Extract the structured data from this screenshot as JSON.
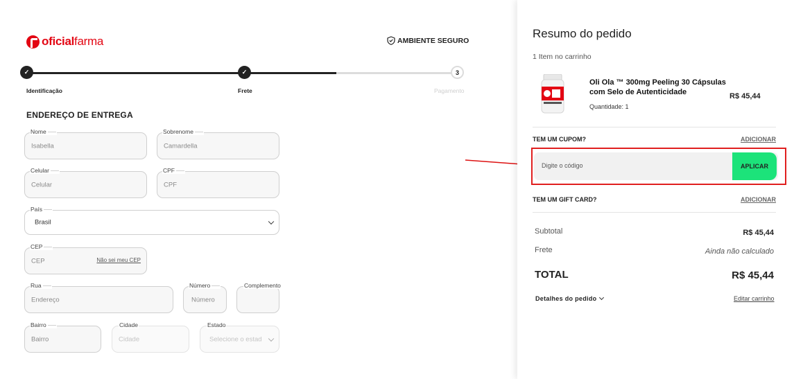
{
  "brand": {
    "logo_part1": "oficial",
    "logo_part2": "farma",
    "secure_label": "AMBIENTE SEGURO"
  },
  "steps": [
    {
      "label": "Identificação",
      "state": "done",
      "marker": "✓"
    },
    {
      "label": "Frete",
      "state": "done",
      "marker": "✓"
    },
    {
      "label": "Pagamento",
      "state": "todo",
      "marker": "3"
    }
  ],
  "form": {
    "title": "ENDEREÇO DE ENTREGA",
    "nome": {
      "label": "Nome",
      "value": "Isabella"
    },
    "sobrenome": {
      "label": "Sobrenome",
      "value": "Camardella"
    },
    "celular": {
      "label": "Celular",
      "placeholder": "Celular"
    },
    "cpf": {
      "label": "CPF",
      "placeholder": "CPF"
    },
    "pais": {
      "label": "País",
      "value": "Brasil"
    },
    "cep": {
      "label": "CEP",
      "placeholder": "CEP",
      "link": "Não sei meu CEP"
    },
    "rua": {
      "label": "Rua",
      "placeholder": "Endereço"
    },
    "numero": {
      "label": "Número",
      "placeholder": "Número"
    },
    "complemento": {
      "label": "Complemento",
      "placeholder": ""
    },
    "bairro": {
      "label": "Bairro",
      "placeholder": "Bairro"
    },
    "cidade": {
      "label": "Cidade",
      "placeholder": "Cidade"
    },
    "estado": {
      "label": "Estado",
      "placeholder": "Selecione o estad"
    }
  },
  "summary": {
    "title": "Resumo do pedido",
    "count": "1 Item no carrinho",
    "product": {
      "name": "Oli Ola ™ 300mg Peeling 30 Cápsulas com Selo de Autenticidade",
      "qty": "Quantidade: 1",
      "price": "R$ 45,44"
    },
    "coupon": {
      "title": "TEM UM CUPOM?",
      "add": "ADICIONAR",
      "placeholder": "Digite o código",
      "apply": "APLICAR"
    },
    "giftcard": {
      "title": "TEM UM GIFT CARD?",
      "add": "ADICIONAR"
    },
    "subtotal": {
      "label": "Subtotal",
      "value": "R$ 45,44"
    },
    "frete": {
      "label": "Frete",
      "value": "Ainda não calculado"
    },
    "total": {
      "label": "TOTAL",
      "value": "R$ 45,44"
    },
    "details": "Detalhes do pedido",
    "edit_cart": "Editar carrinho"
  },
  "colors": {
    "brand_red": "#e30613",
    "apply_green": "#1ce37a",
    "highlight_red": "#e01e1e"
  },
  "icons": [
    "shield-check-icon",
    "check-icon",
    "chevron-down-icon",
    "arrow-icon"
  ]
}
